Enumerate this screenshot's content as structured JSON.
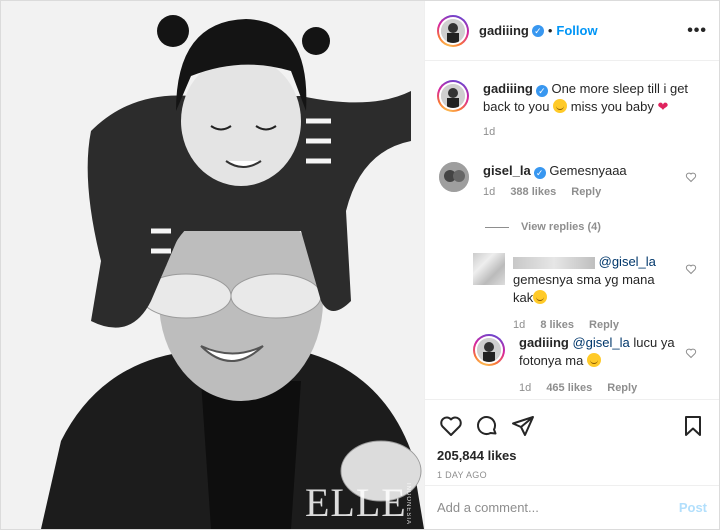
{
  "post": {
    "author": "gadiiing",
    "follow_label": "Follow",
    "more_label": "•••",
    "dot": "•"
  },
  "caption": {
    "username": "gadiiing",
    "text_before_emoji": "One more sleep till i get back to you",
    "text_after_emoji": "miss you baby",
    "time": "1d"
  },
  "comments": [
    {
      "username": "gisel_la",
      "text": "Gemesnyaaa",
      "time": "1d",
      "likes": "388 likes",
      "reply_label": "Reply"
    }
  ],
  "view_replies_label": "View replies (4)",
  "replies": [
    {
      "mention": "@gisel_la",
      "text_line1": "gemesnya sma yg mana",
      "text_line2": "kak",
      "time": "1d",
      "likes": "8 likes",
      "reply_label": "Reply"
    },
    {
      "username": "gadiiing",
      "mention": "@gisel_la",
      "text_after_mention": "lucu ya",
      "text_line2": "fotonya ma",
      "time": "1d",
      "likes": "465 likes",
      "reply_label": "Reply"
    }
  ],
  "stats": {
    "likes": "205,844 likes",
    "time_ago": "1 DAY AGO"
  },
  "add_comment": {
    "placeholder": "Add a comment...",
    "post_label": "Post"
  },
  "watermark": {
    "brand": "ELLE",
    "sub": "INDONESIA"
  },
  "icons": [
    "heart-icon",
    "comment-icon",
    "share-icon",
    "bookmark-icon",
    "verified-icon",
    "more-options-icon",
    "smiling-emoji-icon",
    "red-heart-emoji-icon"
  ],
  "colors": {
    "link": "#0095f6",
    "verified": "#3897f0",
    "muted": "#8e8e8e",
    "post_disabled": "#b2dffc"
  }
}
